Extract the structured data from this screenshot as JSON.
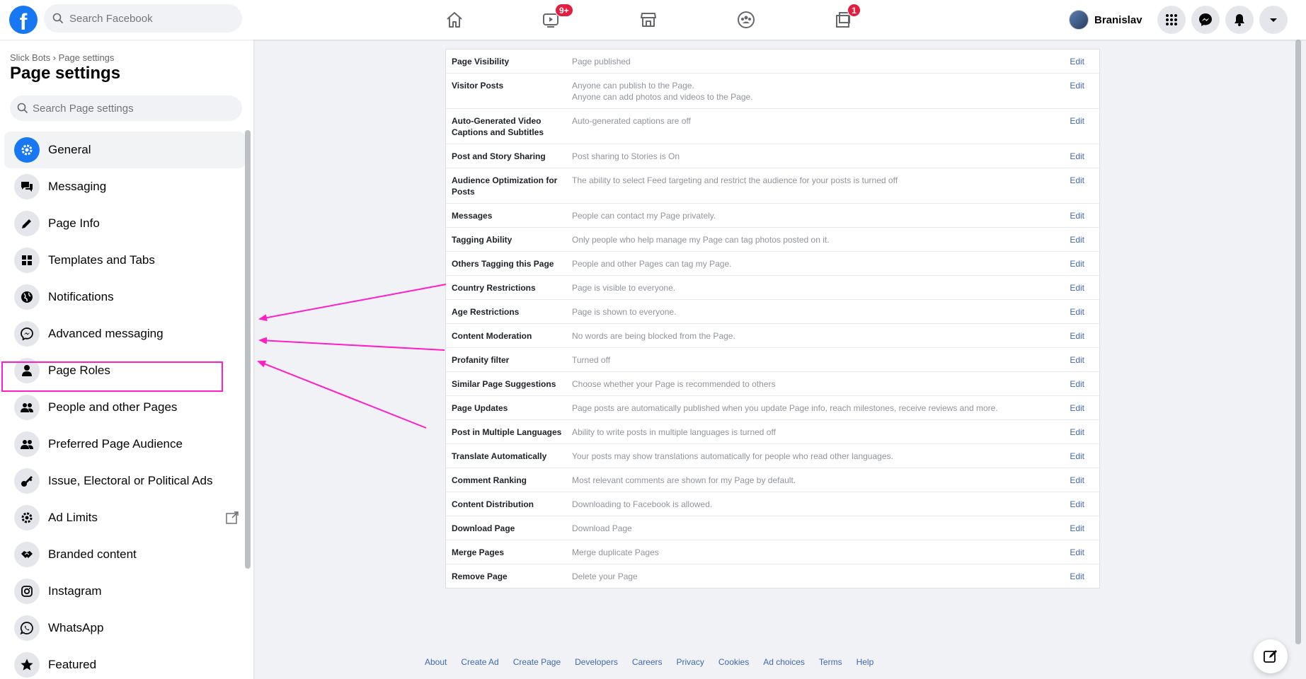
{
  "topbar": {
    "logo": "f",
    "search_placeholder": "Search Facebook",
    "nav": [
      {
        "icon": "home-icon"
      },
      {
        "icon": "watch-icon",
        "badge": "9+"
      },
      {
        "icon": "marketplace-icon"
      },
      {
        "icon": "groups-icon"
      },
      {
        "icon": "gaming-icon",
        "badge": "1"
      }
    ],
    "profile_name": "Branislav",
    "buttons": [
      "menu-grid-icon",
      "messenger-icon",
      "notifications-icon",
      "account-caret-icon"
    ]
  },
  "sidebar": {
    "breadcrumb": "Slick Bots › Page settings",
    "title": "Page settings",
    "search_placeholder": "Search Page settings",
    "items": [
      {
        "label": "General",
        "icon": "gear-icon",
        "active": true
      },
      {
        "label": "Messaging",
        "icon": "chat-bubbles-icon"
      },
      {
        "label": "Page Info",
        "icon": "pencil-icon"
      },
      {
        "label": "Templates and Tabs",
        "icon": "grid-icon"
      },
      {
        "label": "Notifications",
        "icon": "globe-icon"
      },
      {
        "label": "Advanced messaging",
        "icon": "messenger-icon"
      },
      {
        "label": "Page Roles",
        "icon": "person-icon"
      },
      {
        "label": "People and other Pages",
        "icon": "people-icon"
      },
      {
        "label": "Preferred Page Audience",
        "icon": "people-icon"
      },
      {
        "label": "Issue, Electoral or Political Ads",
        "icon": "key-icon"
      },
      {
        "label": "Ad Limits",
        "icon": "gear-icon",
        "external": true
      },
      {
        "label": "Branded content",
        "icon": "handshake-icon"
      },
      {
        "label": "Instagram",
        "icon": "instagram-icon"
      },
      {
        "label": "WhatsApp",
        "icon": "whatsapp-icon"
      },
      {
        "label": "Featured",
        "icon": "star-icon"
      }
    ]
  },
  "settings": [
    {
      "name": "Page Visibility",
      "value": "Page published",
      "edit": "Edit"
    },
    {
      "name": "Visitor Posts",
      "value": "Anyone can publish to the Page.",
      "value2": "Anyone can add photos and videos to the Page.",
      "edit": "Edit"
    },
    {
      "name": "Auto-Generated Video Captions and Subtitles",
      "value": "Auto-generated captions are off",
      "edit": "Edit"
    },
    {
      "name": "Post and Story Sharing",
      "value": "Post sharing to Stories is On",
      "edit": "Edit"
    },
    {
      "name": "Audience Optimization for Posts",
      "value": "The ability to select Feed targeting and restrict the audience for your posts is turned off",
      "edit": "Edit"
    },
    {
      "name": "Messages",
      "value": "People can contact my Page privately.",
      "edit": "Edit"
    },
    {
      "name": "Tagging Ability",
      "value": "Only people who help manage my Page can tag photos posted on it.",
      "edit": "Edit"
    },
    {
      "name": "Others Tagging this Page",
      "value": "People and other Pages can tag my Page.",
      "edit": "Edit"
    },
    {
      "name": "Country Restrictions",
      "value": "Page is visible to everyone.",
      "edit": "Edit"
    },
    {
      "name": "Age Restrictions",
      "value": "Page is shown to everyone.",
      "edit": "Edit"
    },
    {
      "name": "Content Moderation",
      "value": "No words are being blocked from the Page.",
      "edit": "Edit"
    },
    {
      "name": "Profanity filter",
      "value": "Turned off",
      "edit": "Edit"
    },
    {
      "name": "Similar Page Suggestions",
      "value": "Choose whether your Page is recommended to others",
      "edit": "Edit"
    },
    {
      "name": "Page Updates",
      "value": "Page posts are automatically published when you update Page info, reach milestones, receive reviews and more.",
      "edit": "Edit"
    },
    {
      "name": "Post in Multiple Languages",
      "value": "Ability to write posts in multiple languages is turned off",
      "edit": "Edit"
    },
    {
      "name": "Translate Automatically",
      "value": "Your posts may show translations automatically for people who read other languages.",
      "edit": "Edit"
    },
    {
      "name": "Comment Ranking",
      "value": "Most relevant comments are shown for my Page by default.",
      "edit": "Edit"
    },
    {
      "name": "Content Distribution",
      "value": "Downloading to Facebook is allowed.",
      "edit": "Edit"
    },
    {
      "name": "Download Page",
      "value": "Download Page",
      "edit": "Edit"
    },
    {
      "name": "Merge Pages",
      "value": "Merge duplicate Pages",
      "edit": "Edit"
    },
    {
      "name": "Remove Page",
      "value": "Delete your Page",
      "edit": "Edit"
    }
  ],
  "footer": [
    "About",
    "Create Ad",
    "Create Page",
    "Developers",
    "Careers",
    "Privacy",
    "Cookies",
    "Ad choices",
    "Terms",
    "Help"
  ],
  "colors": {
    "accent": "#1877f2",
    "link": "#4267b2",
    "annotation": "#ff1ec8",
    "badge": "#e41e3f"
  }
}
